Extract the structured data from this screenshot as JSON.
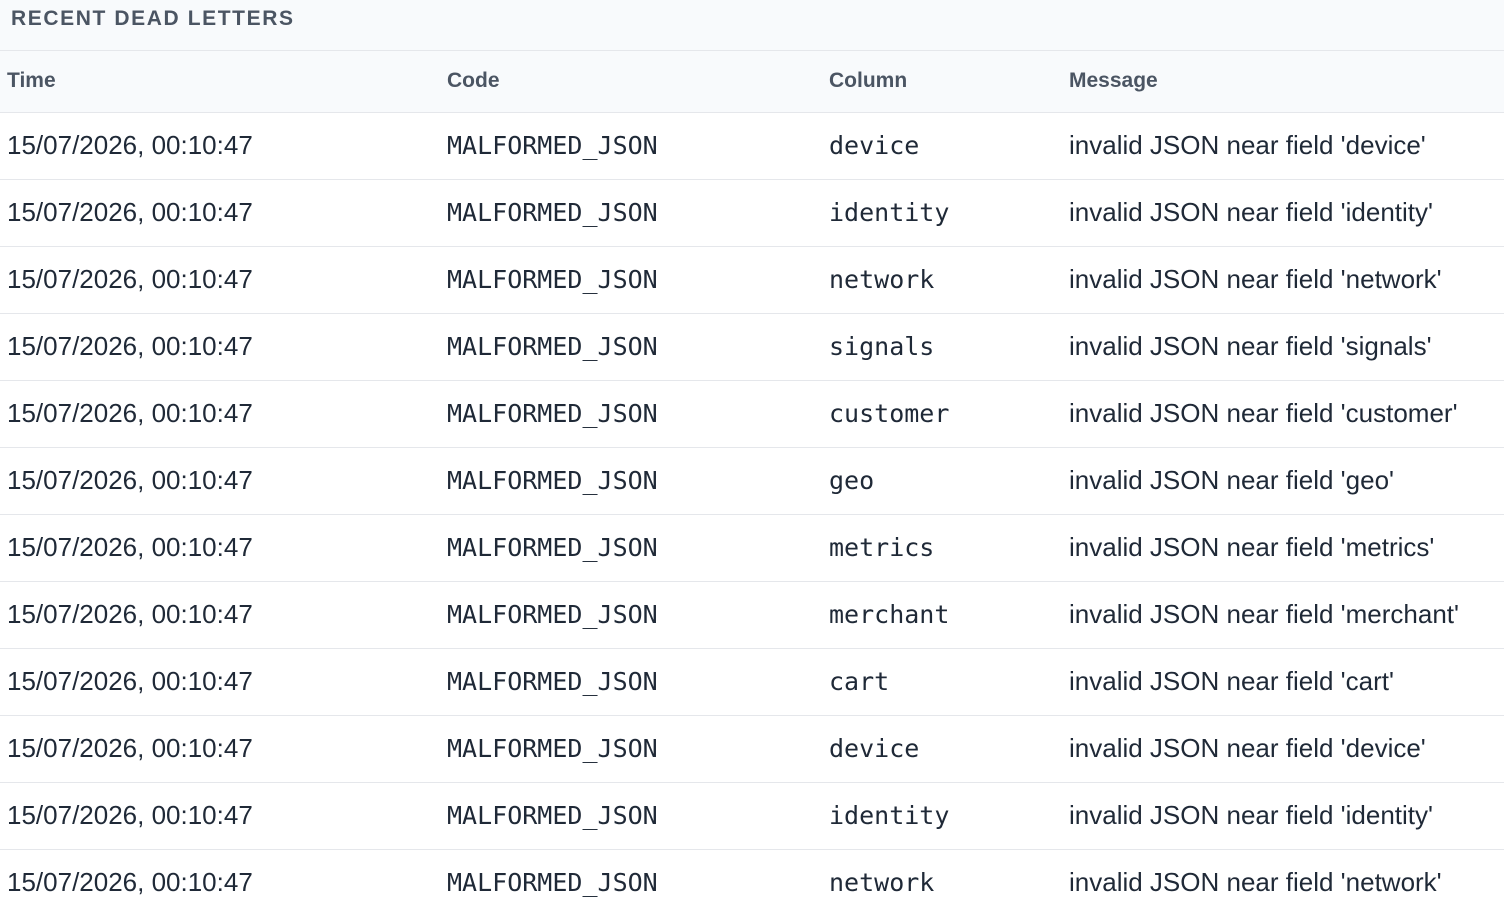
{
  "panel": {
    "title": "RECENT DEAD LETTERS"
  },
  "table": {
    "headers": {
      "time": "Time",
      "code": "Code",
      "column": "Column",
      "message": "Message"
    },
    "rows": [
      {
        "time": "15/07/2026, 00:10:47",
        "code": "MALFORMED_JSON",
        "column": "device",
        "message": "invalid JSON near field 'device'"
      },
      {
        "time": "15/07/2026, 00:10:47",
        "code": "MALFORMED_JSON",
        "column": "identity",
        "message": "invalid JSON near field 'identity'"
      },
      {
        "time": "15/07/2026, 00:10:47",
        "code": "MALFORMED_JSON",
        "column": "network",
        "message": "invalid JSON near field 'network'"
      },
      {
        "time": "15/07/2026, 00:10:47",
        "code": "MALFORMED_JSON",
        "column": "signals",
        "message": "invalid JSON near field 'signals'"
      },
      {
        "time": "15/07/2026, 00:10:47",
        "code": "MALFORMED_JSON",
        "column": "customer",
        "message": "invalid JSON near field 'customer'"
      },
      {
        "time": "15/07/2026, 00:10:47",
        "code": "MALFORMED_JSON",
        "column": "geo",
        "message": "invalid JSON near field 'geo'"
      },
      {
        "time": "15/07/2026, 00:10:47",
        "code": "MALFORMED_JSON",
        "column": "metrics",
        "message": "invalid JSON near field 'metrics'"
      },
      {
        "time": "15/07/2026, 00:10:47",
        "code": "MALFORMED_JSON",
        "column": "merchant",
        "message": "invalid JSON near field 'merchant'"
      },
      {
        "time": "15/07/2026, 00:10:47",
        "code": "MALFORMED_JSON",
        "column": "cart",
        "message": "invalid JSON near field 'cart'"
      },
      {
        "time": "15/07/2026, 00:10:47",
        "code": "MALFORMED_JSON",
        "column": "device",
        "message": "invalid JSON near field 'device'"
      },
      {
        "time": "15/07/2026, 00:10:47",
        "code": "MALFORMED_JSON",
        "column": "identity",
        "message": "invalid JSON near field 'identity'"
      },
      {
        "time": "15/07/2026, 00:10:47",
        "code": "MALFORMED_JSON",
        "column": "network",
        "message": "invalid JSON near field 'network'"
      }
    ]
  }
}
